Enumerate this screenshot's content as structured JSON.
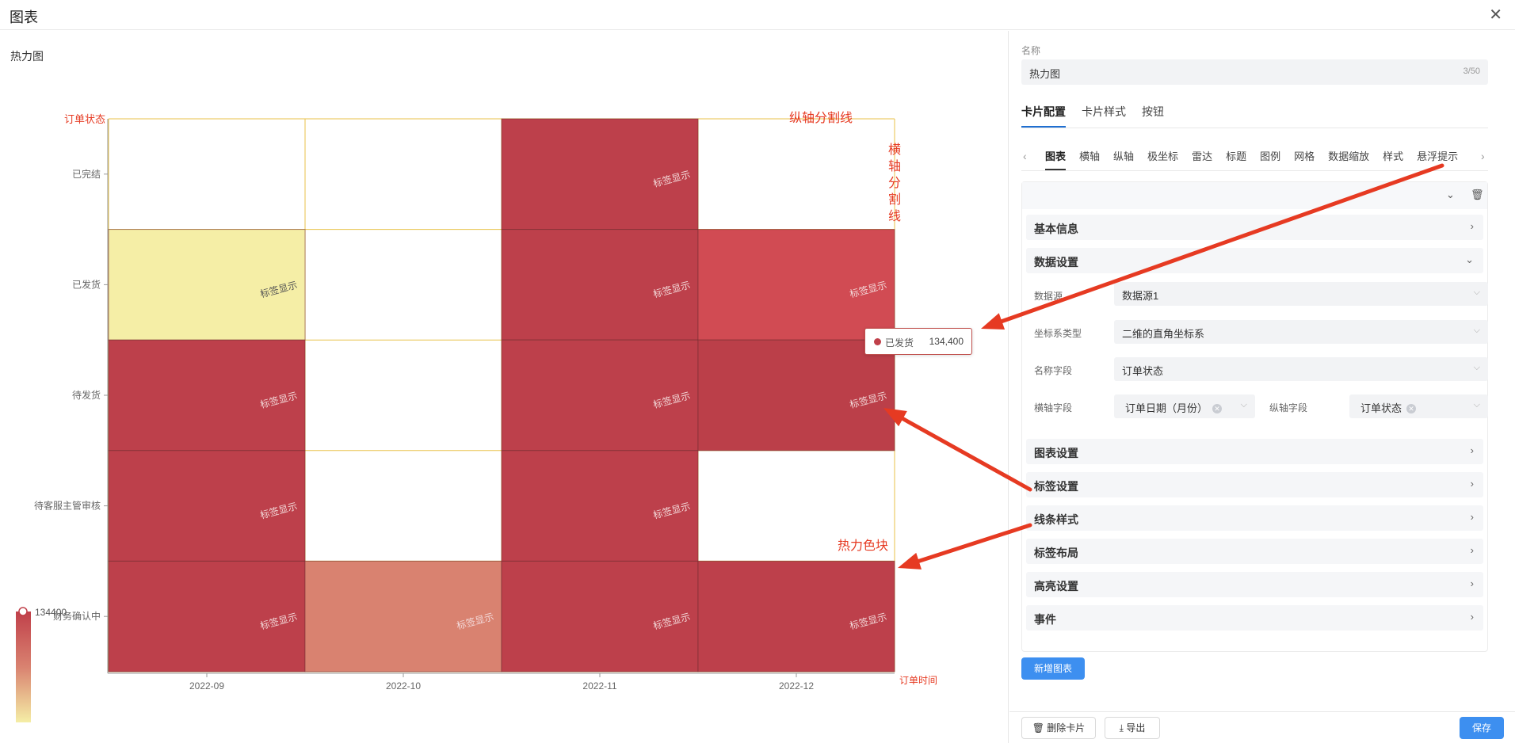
{
  "window": {
    "title": "图表",
    "close_icon": "close-icon"
  },
  "left_panel": {
    "chart_title": "热力图"
  },
  "chart_data": {
    "type": "heatmap",
    "title": "热力图",
    "y_name": "订单状态",
    "x_name": "订单时间",
    "x_categories": [
      "2022-09",
      "2022-10",
      "2022-11",
      "2022-12"
    ],
    "y_categories": [
      "已完结",
      "已发货",
      "待发货",
      "待客服主管审核",
      "财务确认中"
    ],
    "cell_label": "标签显示",
    "cells": [
      {
        "x": "2022-09",
        "y": "已发货",
        "color": "#f5eea6"
      },
      {
        "x": "2022-09",
        "y": "待发货",
        "color": "#bd404b"
      },
      {
        "x": "2022-09",
        "y": "待客服主管审核",
        "color": "#bd404b"
      },
      {
        "x": "2022-09",
        "y": "财务确认中",
        "color": "#bd404b"
      },
      {
        "x": "2022-10",
        "y": "财务确认中",
        "color": "#d98270"
      },
      {
        "x": "2022-11",
        "y": "已完结",
        "color": "#bd404b"
      },
      {
        "x": "2022-11",
        "y": "已发货",
        "color": "#bd404b"
      },
      {
        "x": "2022-11",
        "y": "待发货",
        "color": "#bd404b"
      },
      {
        "x": "2022-11",
        "y": "待客服主管审核",
        "color": "#bd404b"
      },
      {
        "x": "2022-11",
        "y": "财务确认中",
        "color": "#bd404b"
      },
      {
        "x": "2022-12",
        "y": "已发货",
        "color": "#d14b53"
      },
      {
        "x": "2022-12",
        "y": "待发货",
        "color": "#bb3f49"
      },
      {
        "x": "2022-12",
        "y": "财务确认中",
        "color": "#bd404b"
      }
    ],
    "visual_map": {
      "max_label": "134400",
      "colors": [
        "#c0404a",
        "#d98270",
        "#f5eea6"
      ]
    },
    "tooltip": {
      "name": "已发货",
      "value": "134,400",
      "dot_color": "#c0404a"
    },
    "grid_color": "#e8c24a"
  },
  "annotations": {
    "color": "#e63a22",
    "y_split_line": "纵轴分割线",
    "x_split_line": "横轴分割线",
    "heat_block": "热力色块"
  },
  "right_panel": {
    "name_label": "名称",
    "name_value": "热力图",
    "name_count": "3/50",
    "main_tabs": [
      "卡片配置",
      "卡片样式",
      "按钮"
    ],
    "sub_tabs": [
      "图表",
      "横轴",
      "纵轴",
      "极坐标",
      "雷达",
      "标题",
      "图例",
      "网格",
      "数据缩放",
      "样式",
      "悬浮提示"
    ],
    "sections": {
      "basic_info": "基本信息",
      "data_settings": "数据设置",
      "chart_settings": "图表设置",
      "label_settings": "标签设置",
      "line_style": "线条样式",
      "label_layout": "标签布局",
      "highlight_settings": "高亮设置",
      "events": "事件"
    },
    "data_form": {
      "datasource_label": "数据源",
      "datasource_value": "数据源1",
      "coord_label": "坐标系类型",
      "coord_value": "二维的直角坐标系",
      "name_field_label": "名称字段",
      "name_field_value": "订单状态",
      "x_field_label": "横轴字段",
      "x_field_value": "订单日期（月份）",
      "y_field_label": "纵轴字段",
      "y_field_value": "订单状态"
    },
    "add_chart_button": "新增图表",
    "delete_card_button": "删除卡片",
    "export_button": "导出",
    "save_button": "保存"
  }
}
